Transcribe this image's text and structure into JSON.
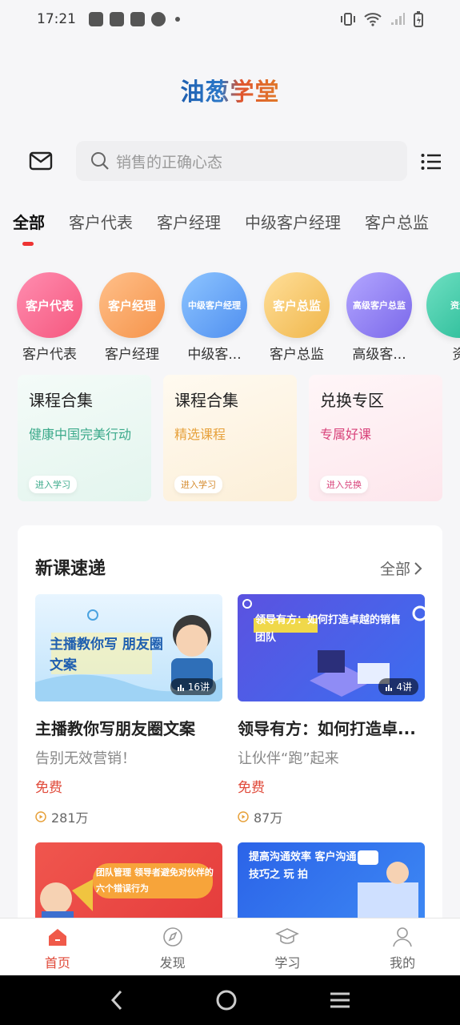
{
  "status": {
    "time": "17:21"
  },
  "app": {
    "logo": "油葱学堂"
  },
  "search": {
    "placeholder": "销售的正确心态"
  },
  "tabs": [
    "全部",
    "客户代表",
    "客户经理",
    "中级客户经理",
    "客户总监"
  ],
  "roles": [
    {
      "badge": "客户代表",
      "label": "客户代表",
      "color_from": "#ff8db0",
      "color_to": "#f5577e"
    },
    {
      "badge": "客户经理",
      "label": "客户经理",
      "color_from": "#ffc08a",
      "color_to": "#f5934a"
    },
    {
      "badge": "中级客户经理",
      "label": "中级客...",
      "color_from": "#8ec5ff",
      "color_to": "#4f8ff0"
    },
    {
      "badge": "客户总监",
      "label": "客户总监",
      "color_from": "#ffdf9a",
      "color_to": "#f0b64a"
    },
    {
      "badge": "高级客户总监",
      "label": "高级客...",
      "color_from": "#b3a6ff",
      "color_to": "#7a68ea"
    },
    {
      "badge": "资源",
      "label": "资",
      "color_from": "#6fe0c2",
      "color_to": "#23b894"
    }
  ],
  "promo_cards": [
    {
      "title": "课程合集",
      "subtitle": "健康中国完美行动",
      "action": "进入学习",
      "sub_color": "#3aa98a",
      "bg": "#eaf7f1"
    },
    {
      "title": "课程合集",
      "subtitle": "精选课程",
      "action": "进入学习",
      "sub_color": "#e7a13b",
      "bg": "#fdf4e4"
    },
    {
      "title": "兑换专区",
      "subtitle": "专属好课",
      "action": "进入兑换",
      "sub_color": "#d8427a",
      "bg": "#fdeef2"
    }
  ],
  "new_courses": {
    "title": "新课速递",
    "all_label": "全部",
    "items": [
      {
        "banner": "主播教你写 朋友圈文案",
        "lessons": "16讲",
        "title": "主播教你写朋友圈文案",
        "subtitle": "告别无效营销！",
        "price": "免费",
        "views": "281万"
      },
      {
        "banner": "领导有方：如何打造卓越的销售团队",
        "lessons": "4讲",
        "title": "领导有方：如何打造卓...",
        "subtitle": "让伙伴“跑”起来",
        "price": "免费",
        "views": "87万"
      },
      {
        "banner": "团队管理 领导者避免对伙伴的六个错误行为",
        "lessons": "",
        "title": "",
        "subtitle": "",
        "price": "",
        "views": ""
      },
      {
        "banner": "提高沟通效率 客户沟通技巧之 玩 拍",
        "lessons": "",
        "title": "",
        "subtitle": "",
        "price": "",
        "views": ""
      }
    ]
  },
  "bottom_nav": [
    {
      "label": "首页",
      "icon": "home-icon",
      "active": true
    },
    {
      "label": "发现",
      "icon": "compass-icon",
      "active": false
    },
    {
      "label": "学习",
      "icon": "graduation-cap-icon",
      "active": false
    },
    {
      "label": "我的",
      "icon": "user-icon",
      "active": false
    }
  ],
  "colors": {
    "accent": "#e04a3a",
    "tab_indicator": "#ee3333"
  }
}
